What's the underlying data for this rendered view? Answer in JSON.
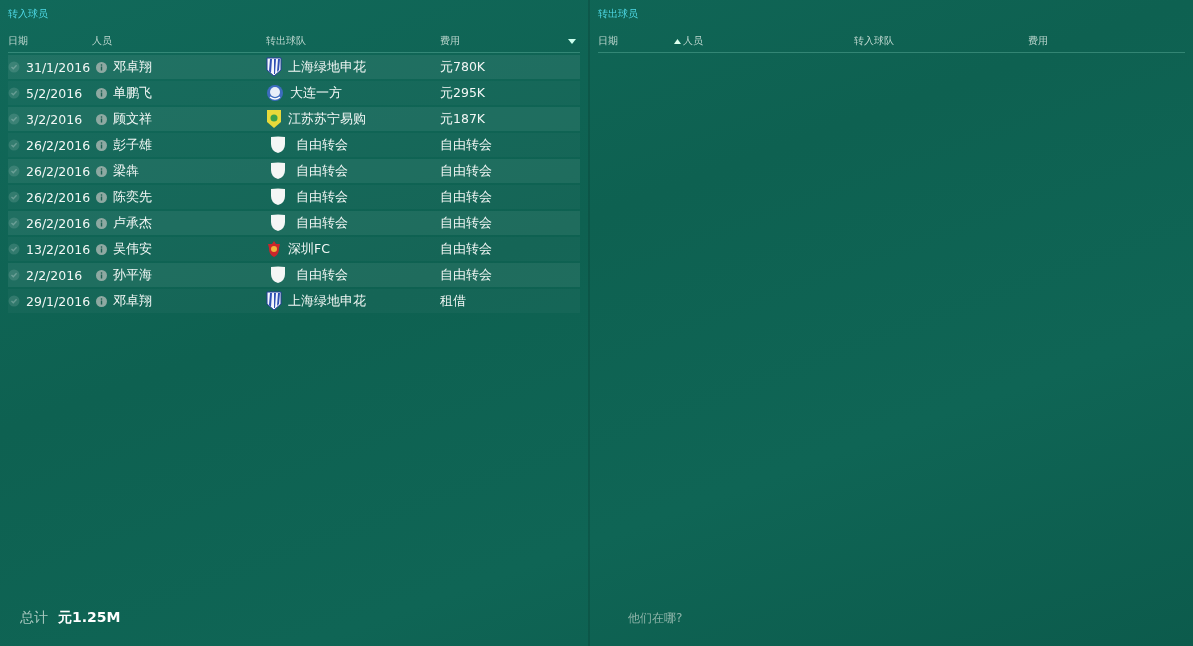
{
  "incoming": {
    "title": "转入球员",
    "columns": [
      {
        "label": "日期",
        "sort_up": false,
        "sort_down": false
      },
      {
        "label": "人员",
        "sort_up": false,
        "sort_down": false
      },
      {
        "label": "转出球队",
        "sort_up": false,
        "sort_down": false
      },
      {
        "label": "费用",
        "sort_up": false,
        "sort_down": true
      }
    ],
    "rows": [
      {
        "date": "31/1/2016",
        "name": "邓卓翔",
        "club": "上海绿地申花",
        "crest": {
          "kind": "stripes"
        },
        "fee": "元780K"
      },
      {
        "date": "5/2/2016",
        "name": "单鹏飞",
        "club": "大连一方",
        "crest": {
          "kind": "globe"
        },
        "fee": "元295K"
      },
      {
        "date": "3/2/2016",
        "name": "顾文祥",
        "club": "江苏苏宁易购",
        "crest": {
          "kind": "emblem"
        },
        "fee": "元187K"
      },
      {
        "date": "26/2/2016",
        "name": "彭子雄",
        "club": "自由转会",
        "crest": {
          "kind": "blank"
        },
        "fee": "自由转会"
      },
      {
        "date": "26/2/2016",
        "name": "梁犇",
        "club": "自由转会",
        "crest": {
          "kind": "blank"
        },
        "fee": "自由转会"
      },
      {
        "date": "26/2/2016",
        "name": "陈奕先",
        "club": "自由转会",
        "crest": {
          "kind": "blank"
        },
        "fee": "自由转会"
      },
      {
        "date": "26/2/2016",
        "name": "卢承杰",
        "club": "自由转会",
        "crest": {
          "kind": "blank"
        },
        "fee": "自由转会"
      },
      {
        "date": "13/2/2016",
        "name": "吴伟安",
        "club": "深圳FC",
        "crest": {
          "kind": "crown"
        },
        "fee": "自由转会"
      },
      {
        "date": "2/2/2016",
        "name": "孙平海",
        "club": "自由转会",
        "crest": {
          "kind": "blank"
        },
        "fee": "自由转会"
      },
      {
        "date": "29/1/2016",
        "name": "邓卓翔",
        "club": "上海绿地申花",
        "crest": {
          "kind": "stripes"
        },
        "fee": "租借"
      }
    ],
    "footer": {
      "label": "总计",
      "value": "元1.25M"
    }
  },
  "outgoing": {
    "title": "转出球员",
    "columns": [
      {
        "label": "日期",
        "sort_up": false,
        "sort_down": false
      },
      {
        "label": "人员",
        "sort_up": true,
        "sort_down": false
      },
      {
        "label": "转入球队",
        "sort_up": false,
        "sort_down": false
      },
      {
        "label": "费用",
        "sort_up": false,
        "sort_down": false
      }
    ],
    "footer": {
      "hint": "他们在哪?"
    }
  }
}
